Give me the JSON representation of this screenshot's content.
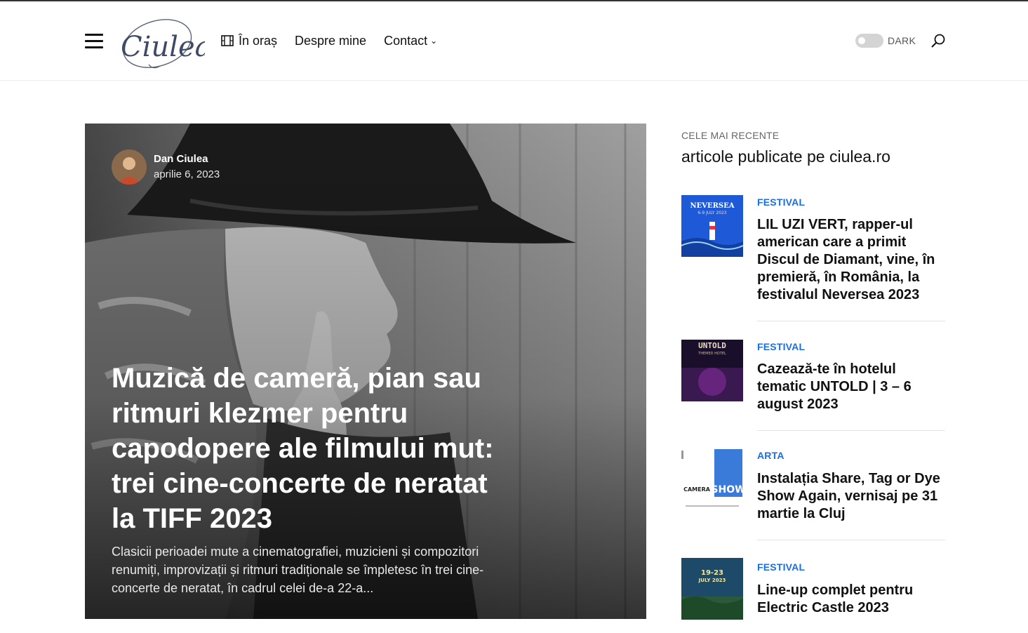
{
  "site": {
    "logo_text": "Ciulea"
  },
  "nav": {
    "items": [
      {
        "label": "În oraș",
        "icon": "film-icon"
      },
      {
        "label": "Despre mine"
      },
      {
        "label": "Contact",
        "has_dropdown": true
      }
    ]
  },
  "header": {
    "dark_label": "DARK",
    "dark_mode_on": false
  },
  "hero": {
    "author": "Dan Ciulea",
    "date": "aprilie 6, 2023",
    "title": "Muzică de cameră, pian sau ritmuri klezmer pentru capodopere ale filmului mut: trei cine-concerte de neratat la TIFF 2023",
    "excerpt": "Clasicii perioadei mute a cinematografiei, muzicieni și compozitori renumiți, improvizații și ritmuri tradiționale se împletesc în trei cine-concerte de neratat, în cadrul celei de-a 22-a..."
  },
  "sidebar": {
    "label": "CELE MAI RECENTE",
    "heading": "articole publicate pe ciulea.ro",
    "posts": [
      {
        "category": "FESTIVAL",
        "title": "LIL UZI VERT, rapper-ul american care a primit Discul de Diamant, vine, în premieră, în România, la festivalul Neversea 2023",
        "thumb_text": "NEVERSEA",
        "thumb_sub": "6-9 JULY 2023"
      },
      {
        "category": "FESTIVAL",
        "title": "Cazează-te în hotelul tematic UNTOLD | 3 – 6 august 2023",
        "thumb_text": "UNTOLD",
        "thumb_sub": "THEMED HOTEL"
      },
      {
        "category": "ARTA",
        "title": "Instalația Share, Tag or Dye Show Again, vernisaj pe 31 martie la Cluj",
        "thumb_text": "CAMERA",
        "thumb_sub": "SHOW"
      },
      {
        "category": "FESTIVAL",
        "title": "Line-up complet pentru Electric Castle 2023",
        "thumb_text": "19-23",
        "thumb_sub": "JULY 2023"
      }
    ]
  },
  "colors": {
    "accent": "#1a6ee6",
    "text": "#111111"
  }
}
